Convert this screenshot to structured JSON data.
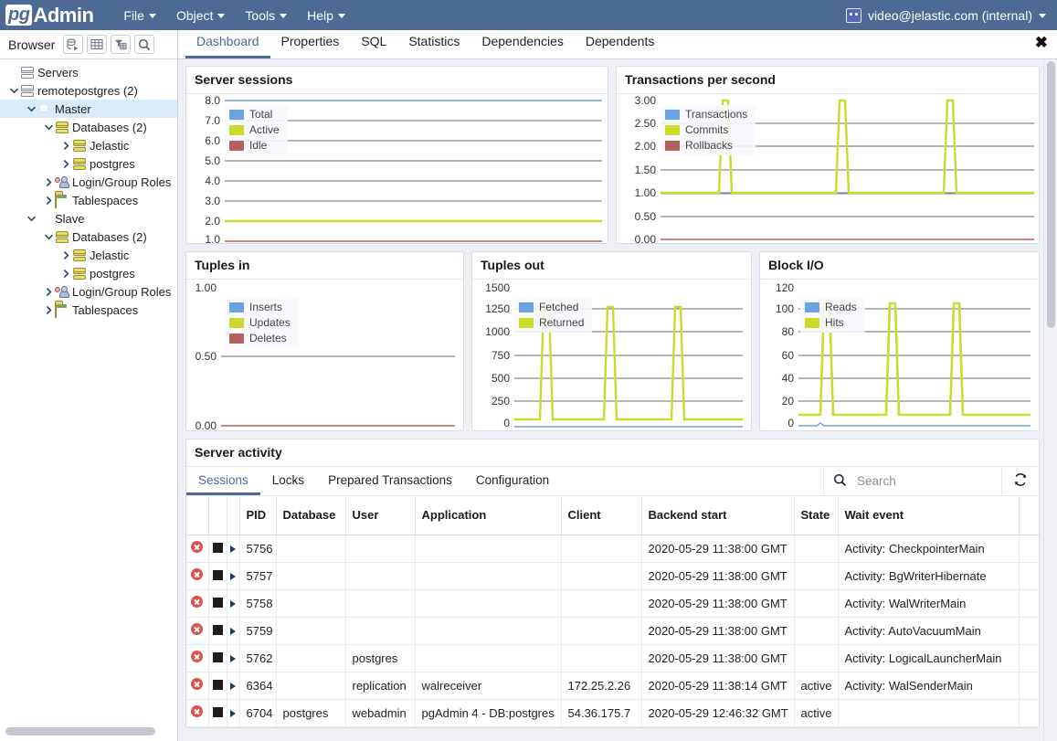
{
  "app": {
    "brand_pg": "pg",
    "brand_admin": "Admin",
    "menus": [
      "File",
      "Object",
      "Tools",
      "Help"
    ],
    "user": "video@jelastic.com (internal)",
    "user_icon": "robot-icon"
  },
  "browser": {
    "title": "Browser",
    "tools": [
      "query-tool-icon",
      "view-data-icon",
      "filtered-rows-icon",
      "search-icon"
    ],
    "tree": [
      {
        "label": "Servers",
        "indent": 0,
        "arrow": "none",
        "icon": "server-icon",
        "selected": false
      },
      {
        "label": "remotepostgres (2)",
        "indent": 0,
        "arrow": "down",
        "icon": "server-icon",
        "selected": false
      },
      {
        "label": "Master",
        "indent": 1,
        "arrow": "down",
        "icon": "postgres-icon",
        "selected": true
      },
      {
        "label": "Databases (2)",
        "indent": 2,
        "arrow": "down",
        "icon": "database-icon",
        "selected": false
      },
      {
        "label": "Jelastic",
        "indent": 3,
        "arrow": "right",
        "icon": "database-icon",
        "selected": false
      },
      {
        "label": "postgres",
        "indent": 3,
        "arrow": "right",
        "icon": "database-icon",
        "selected": false
      },
      {
        "label": "Login/Group Roles",
        "indent": 2,
        "arrow": "right",
        "icon": "roles-icon",
        "selected": false
      },
      {
        "label": "Tablespaces",
        "indent": 2,
        "arrow": "right",
        "icon": "tablespace-icon",
        "selected": false
      },
      {
        "label": "Slave",
        "indent": 1,
        "arrow": "down",
        "icon": "postgres-icon",
        "selected": false
      },
      {
        "label": "Databases (2)",
        "indent": 2,
        "arrow": "down",
        "icon": "database-icon",
        "selected": false
      },
      {
        "label": "Jelastic",
        "indent": 3,
        "arrow": "right",
        "icon": "database-icon",
        "selected": false
      },
      {
        "label": "postgres",
        "indent": 3,
        "arrow": "right",
        "icon": "database-icon",
        "selected": false
      },
      {
        "label": "Login/Group Roles",
        "indent": 2,
        "arrow": "right",
        "icon": "roles-icon",
        "selected": false
      },
      {
        "label": "Tablespaces",
        "indent": 2,
        "arrow": "right",
        "icon": "tablespace-icon",
        "selected": false
      }
    ]
  },
  "tabs": [
    {
      "label": "Dashboard",
      "active": true
    },
    {
      "label": "Properties",
      "active": false
    },
    {
      "label": "SQL",
      "active": false
    },
    {
      "label": "Statistics",
      "active": false
    },
    {
      "label": "Dependencies",
      "active": false
    },
    {
      "label": "Dependents",
      "active": false
    }
  ],
  "tab_close_glyph": "✖",
  "colors": {
    "blue": "#6ba3e0",
    "green": "#cbdb2a",
    "red": "#b5605e",
    "accent": "#4d6a97",
    "grid": "#6e6e6e"
  },
  "chart_data": [
    {
      "type": "line",
      "title": "Server sessions",
      "ylim": [
        1.0,
        8.0
      ],
      "yticks": [
        "8.0",
        "7.0",
        "6.0",
        "5.0",
        "4.0",
        "3.0",
        "2.0",
        "1.0"
      ],
      "grid": true,
      "legend_position": "top-left",
      "series": [
        {
          "name": "Total",
          "color": "#6ba3e0",
          "constant": 8
        },
        {
          "name": "Active",
          "color": "#cbdb2a",
          "constant": 2
        },
        {
          "name": "Idle",
          "color": "#b5605e",
          "constant": 1
        }
      ]
    },
    {
      "type": "line",
      "title": "Transactions per second",
      "ylim": [
        0.0,
        3.0
      ],
      "yticks": [
        "3.00",
        "2.50",
        "2.00",
        "1.50",
        "1.00",
        "0.50",
        "0.00"
      ],
      "grid": true,
      "legend_position": "top-left",
      "series": [
        {
          "name": "Transactions",
          "color": "#6ba3e0",
          "constant": 1
        },
        {
          "name": "Commits",
          "color": "#cbdb2a",
          "baseline": 1,
          "spikes": [
            3,
            3,
            3
          ]
        },
        {
          "name": "Rollbacks",
          "color": "#b5605e",
          "constant": 0
        }
      ]
    },
    {
      "type": "line",
      "title": "Tuples in",
      "ylim": [
        0.0,
        1.0
      ],
      "yticks": [
        "1.00",
        "0.50",
        "0.00"
      ],
      "grid": true,
      "legend_position": "top-left",
      "series": [
        {
          "name": "Inserts",
          "color": "#6ba3e0",
          "constant": 0
        },
        {
          "name": "Updates",
          "color": "#cbdb2a",
          "constant": 0
        },
        {
          "name": "Deletes",
          "color": "#b5605e",
          "constant": 0
        }
      ]
    },
    {
      "type": "line",
      "title": "Tuples out",
      "ylim": [
        0,
        1500
      ],
      "yticks": [
        "1500",
        "1250",
        "1000",
        "750",
        "500",
        "250",
        "0"
      ],
      "grid": true,
      "legend_position": "top-left",
      "series": [
        {
          "name": "Fetched",
          "color": "#6ba3e0",
          "constant": 5
        },
        {
          "name": "Returned",
          "color": "#cbdb2a",
          "baseline": 30,
          "spikes": [
            1300,
            1300,
            1300
          ]
        }
      ]
    },
    {
      "type": "line",
      "title": "Block I/O",
      "ylim": [
        0,
        120
      ],
      "yticks": [
        "120",
        "100",
        "80",
        "60",
        "40",
        "20",
        "0"
      ],
      "grid": true,
      "legend_position": "top-left",
      "series": [
        {
          "name": "Reads",
          "color": "#6ba3e0",
          "constant": 0
        },
        {
          "name": "Hits",
          "color": "#cbdb2a",
          "baseline": 9,
          "spikes": [
            107,
            107,
            107
          ]
        }
      ]
    }
  ],
  "activity": {
    "title": "Server activity",
    "tabs": [
      {
        "label": "Sessions",
        "active": true
      },
      {
        "label": "Locks",
        "active": false
      },
      {
        "label": "Prepared Transactions",
        "active": false
      },
      {
        "label": "Configuration",
        "active": false
      }
    ],
    "search_placeholder": "Search",
    "search_value": "",
    "search_icon": "search-icon",
    "refresh_icon": "refresh-icon",
    "columns": [
      "PID",
      "Database",
      "User",
      "Application",
      "Client",
      "Backend start",
      "State",
      "Wait event"
    ],
    "row_icons": {
      "terminate": "terminate-icon",
      "cancel": "stop-icon",
      "expand": "expand-icon"
    },
    "rows": [
      {
        "pid": "5756",
        "database": "",
        "user": "",
        "application": "",
        "client": "",
        "backend_start": "2020-05-29 11:38:00 GMT",
        "state": "",
        "wait_event": "Activity: CheckpointerMain"
      },
      {
        "pid": "5757",
        "database": "",
        "user": "",
        "application": "",
        "client": "",
        "backend_start": "2020-05-29 11:38:00 GMT",
        "state": "",
        "wait_event": "Activity: BgWriterHibernate"
      },
      {
        "pid": "5758",
        "database": "",
        "user": "",
        "application": "",
        "client": "",
        "backend_start": "2020-05-29 11:38:00 GMT",
        "state": "",
        "wait_event": "Activity: WalWriterMain"
      },
      {
        "pid": "5759",
        "database": "",
        "user": "",
        "application": "",
        "client": "",
        "backend_start": "2020-05-29 11:38:00 GMT",
        "state": "",
        "wait_event": "Activity: AutoVacuumMain"
      },
      {
        "pid": "5762",
        "database": "",
        "user": "postgres",
        "application": "",
        "client": "",
        "backend_start": "2020-05-29 11:38:00 GMT",
        "state": "",
        "wait_event": "Activity: LogicalLauncherMain"
      },
      {
        "pid": "6364",
        "database": "",
        "user": "replication",
        "application": "walreceiver",
        "client": "172.25.2.26",
        "backend_start": "2020-05-29 11:38:14 GMT",
        "state": "active",
        "wait_event": "Activity: WalSenderMain"
      },
      {
        "pid": "6704",
        "database": "postgres",
        "user": "webadmin",
        "application": "pgAdmin 4 - DB:postgres",
        "client": "54.36.175.7",
        "backend_start": "2020-05-29 12:46:32 GMT",
        "state": "active",
        "wait_event": ""
      }
    ]
  }
}
